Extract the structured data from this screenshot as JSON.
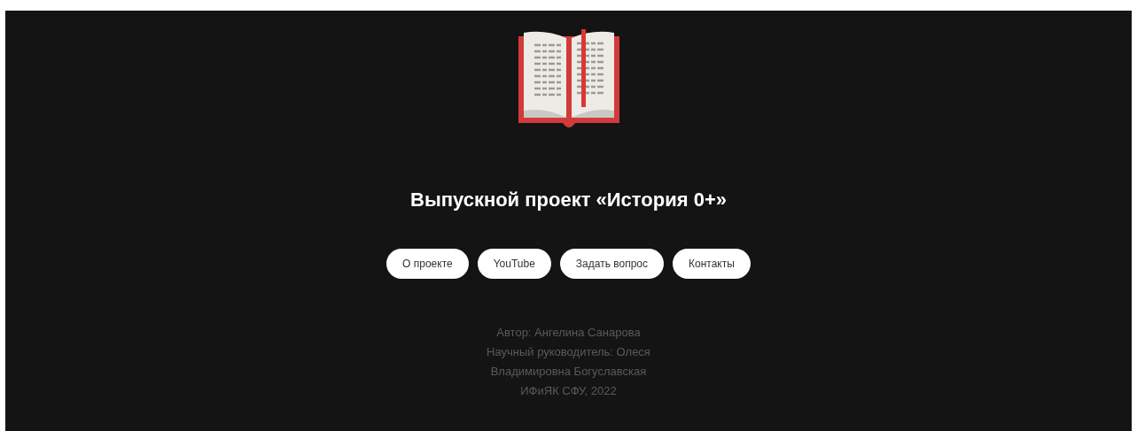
{
  "title": "Выпускной проект «История 0+»",
  "buttons": [
    "О проекте",
    "YouTube",
    "Задать вопрос",
    "Контакты"
  ],
  "credits": [
    "Автор: Ангелина Санарова",
    "Научный руководитель: Олеся",
    "Владимировна Богуславская",
    "ИФиЯК СФУ, 2022"
  ]
}
